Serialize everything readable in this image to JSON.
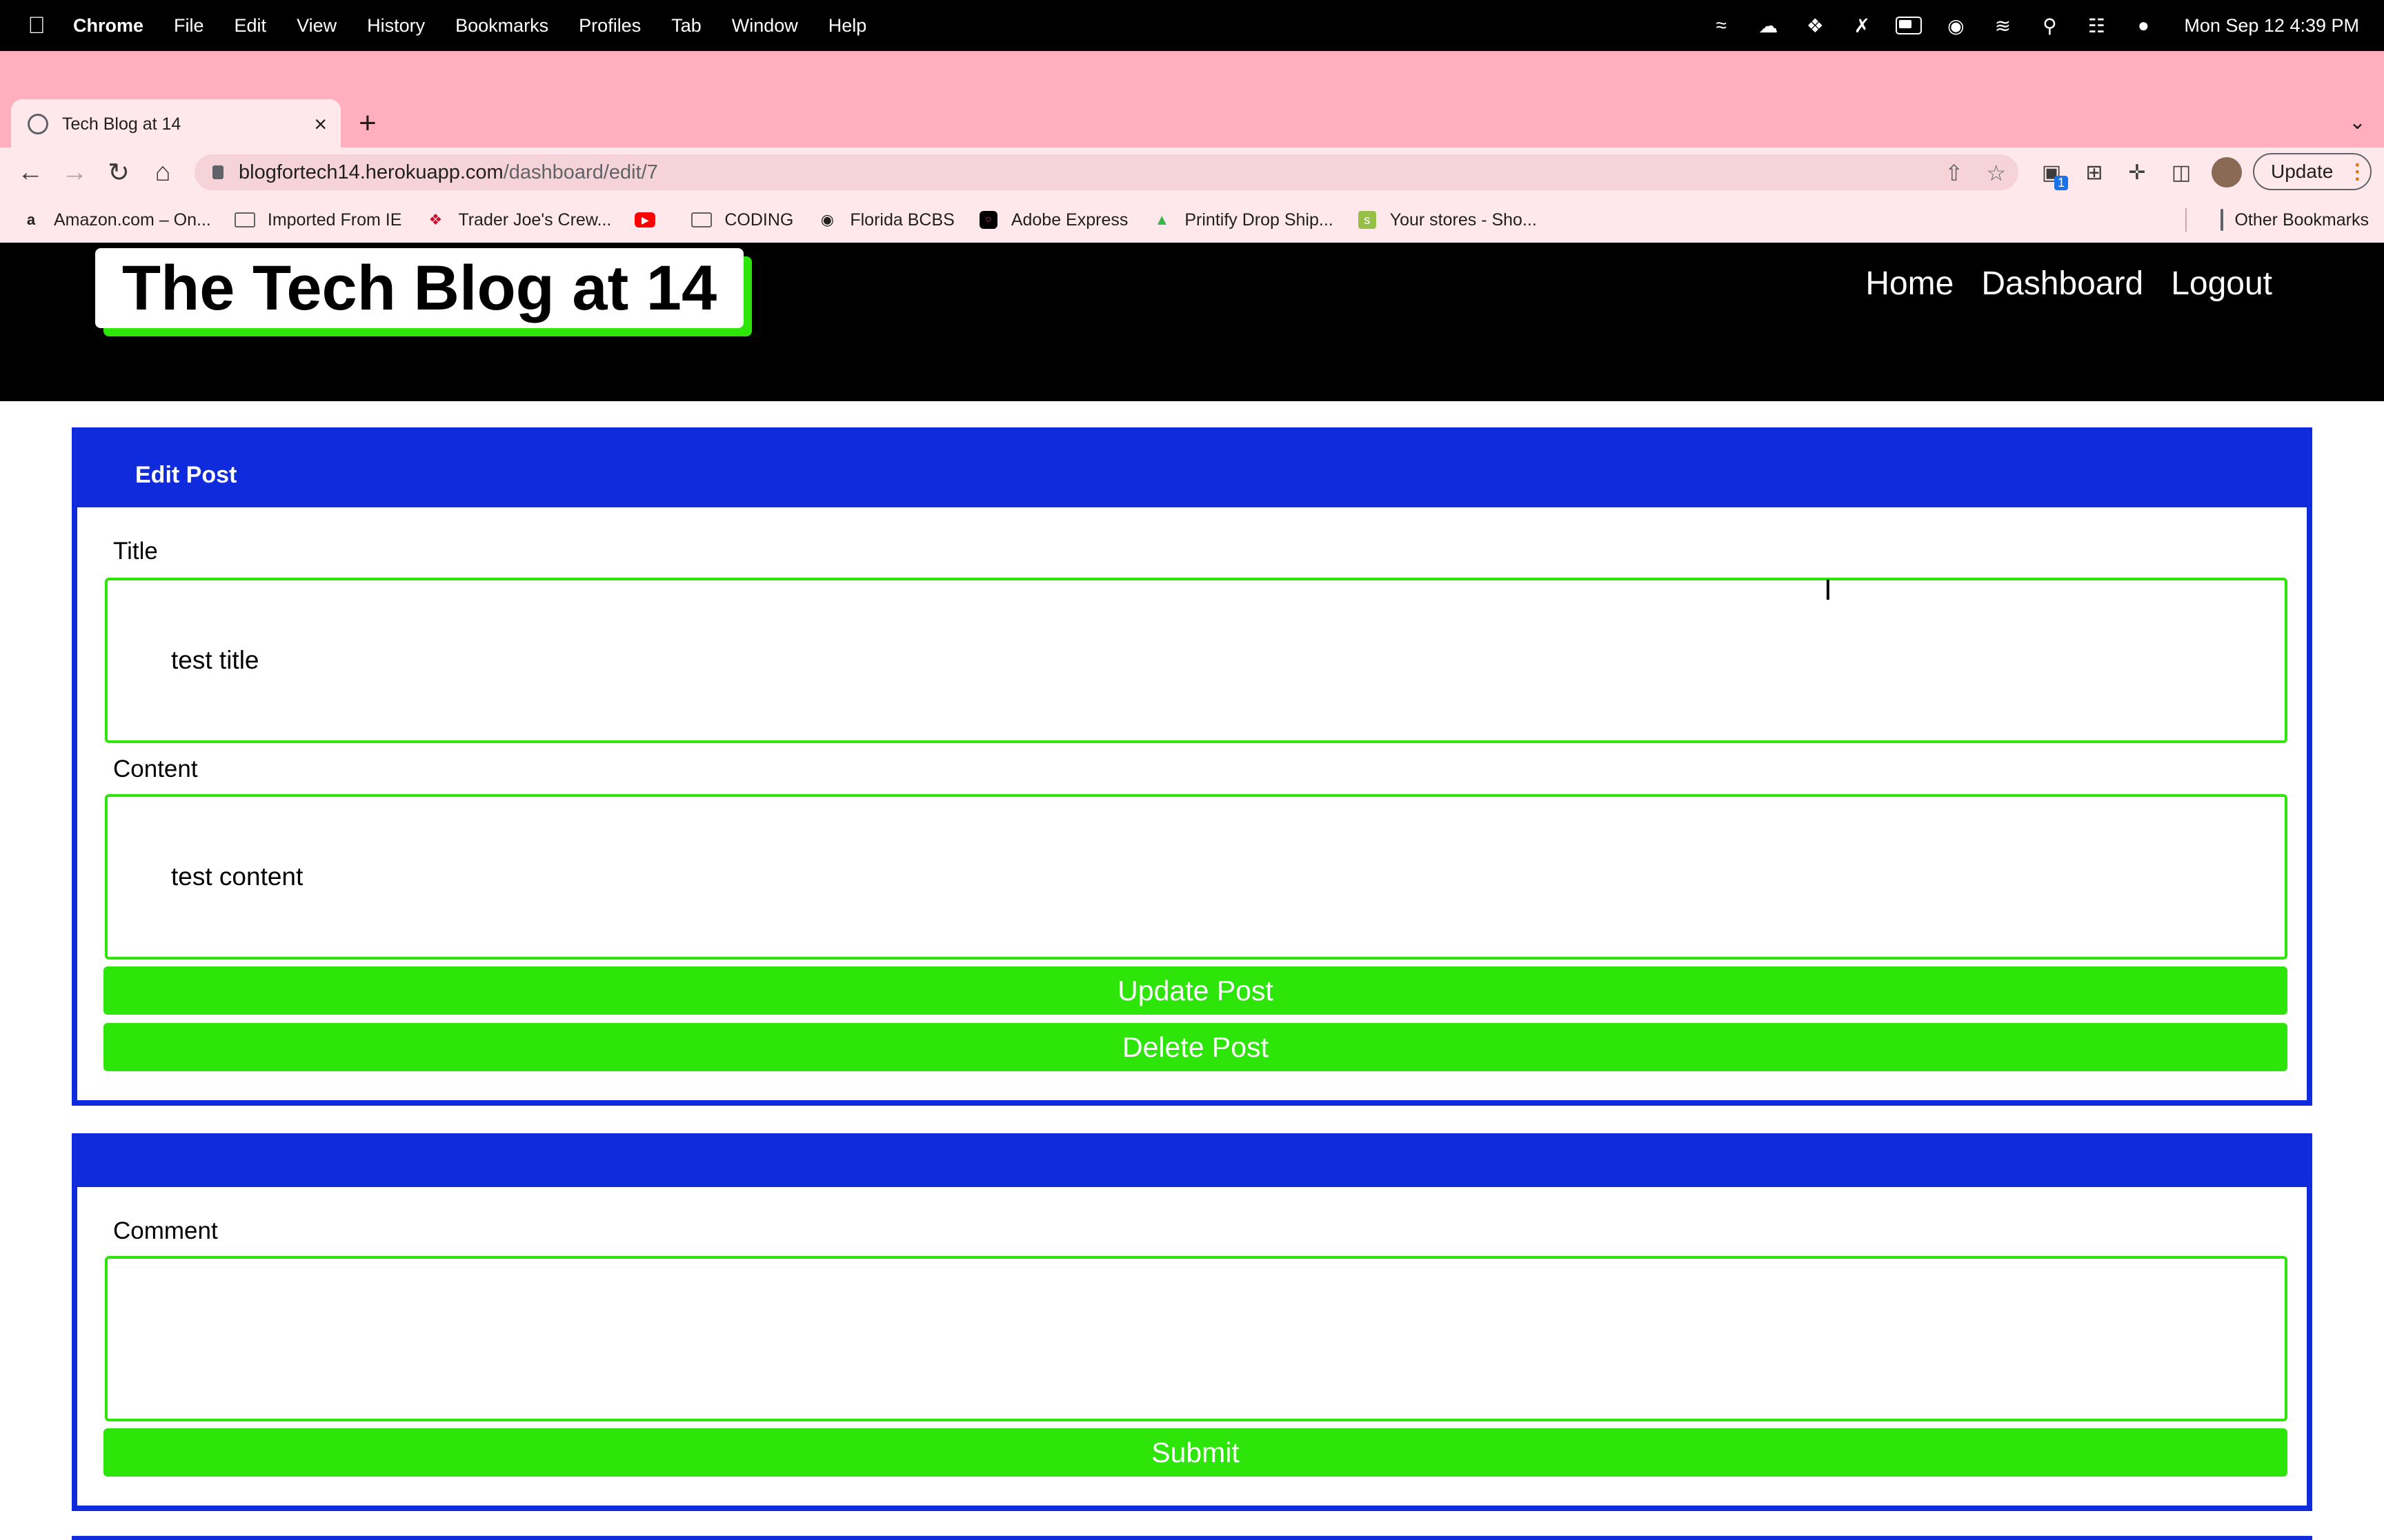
{
  "menubar": {
    "app": "Chrome",
    "items": [
      "File",
      "Edit",
      "View",
      "History",
      "Bookmarks",
      "Profiles",
      "Tab",
      "Window",
      "Help"
    ],
    "clock": "Mon Sep 12  4:39 PM"
  },
  "browser": {
    "tab": {
      "title": "Tech Blog at 14"
    },
    "url": {
      "host": "blogfortech14.herokuapp.com",
      "path": "/dashboard/edit/7"
    },
    "extension_badge": "1",
    "update_label": "Update",
    "bookmarks": [
      {
        "label": "Amazon.com – On...",
        "icon": "amazon-icon"
      },
      {
        "label": "Imported From IE",
        "icon": "folder-icon"
      },
      {
        "label": "Trader Joe's Crew...",
        "icon": "traderjoes-icon"
      },
      {
        "label": "",
        "icon": "youtube-icon"
      },
      {
        "label": "CODING",
        "icon": "folder-icon"
      },
      {
        "label": "Florida BCBS",
        "icon": "globe-icon"
      },
      {
        "label": "Adobe Express",
        "icon": "adobe-express-icon"
      },
      {
        "label": "Printify Drop Ship...",
        "icon": "printify-icon"
      },
      {
        "label": "Your stores - Sho...",
        "icon": "shopify-icon"
      }
    ],
    "other_bookmarks": "Other Bookmarks"
  },
  "site": {
    "logo": "The Tech Blog at 14",
    "nav": [
      "Home",
      "Dashboard",
      "Logout"
    ]
  },
  "edit_post": {
    "header": "Edit Post",
    "title_label": "Title",
    "title_value": "test title",
    "content_label": "Content",
    "content_value": "test content",
    "update_button": "Update Post",
    "delete_button": "Delete Post"
  },
  "comment": {
    "label": "Comment",
    "value": "",
    "submit_button": "Submit"
  },
  "colors": {
    "brand_blue": "#0f2bdc",
    "brand_green": "#2ee50a",
    "tabstrip_pink": "#ffafbd"
  }
}
